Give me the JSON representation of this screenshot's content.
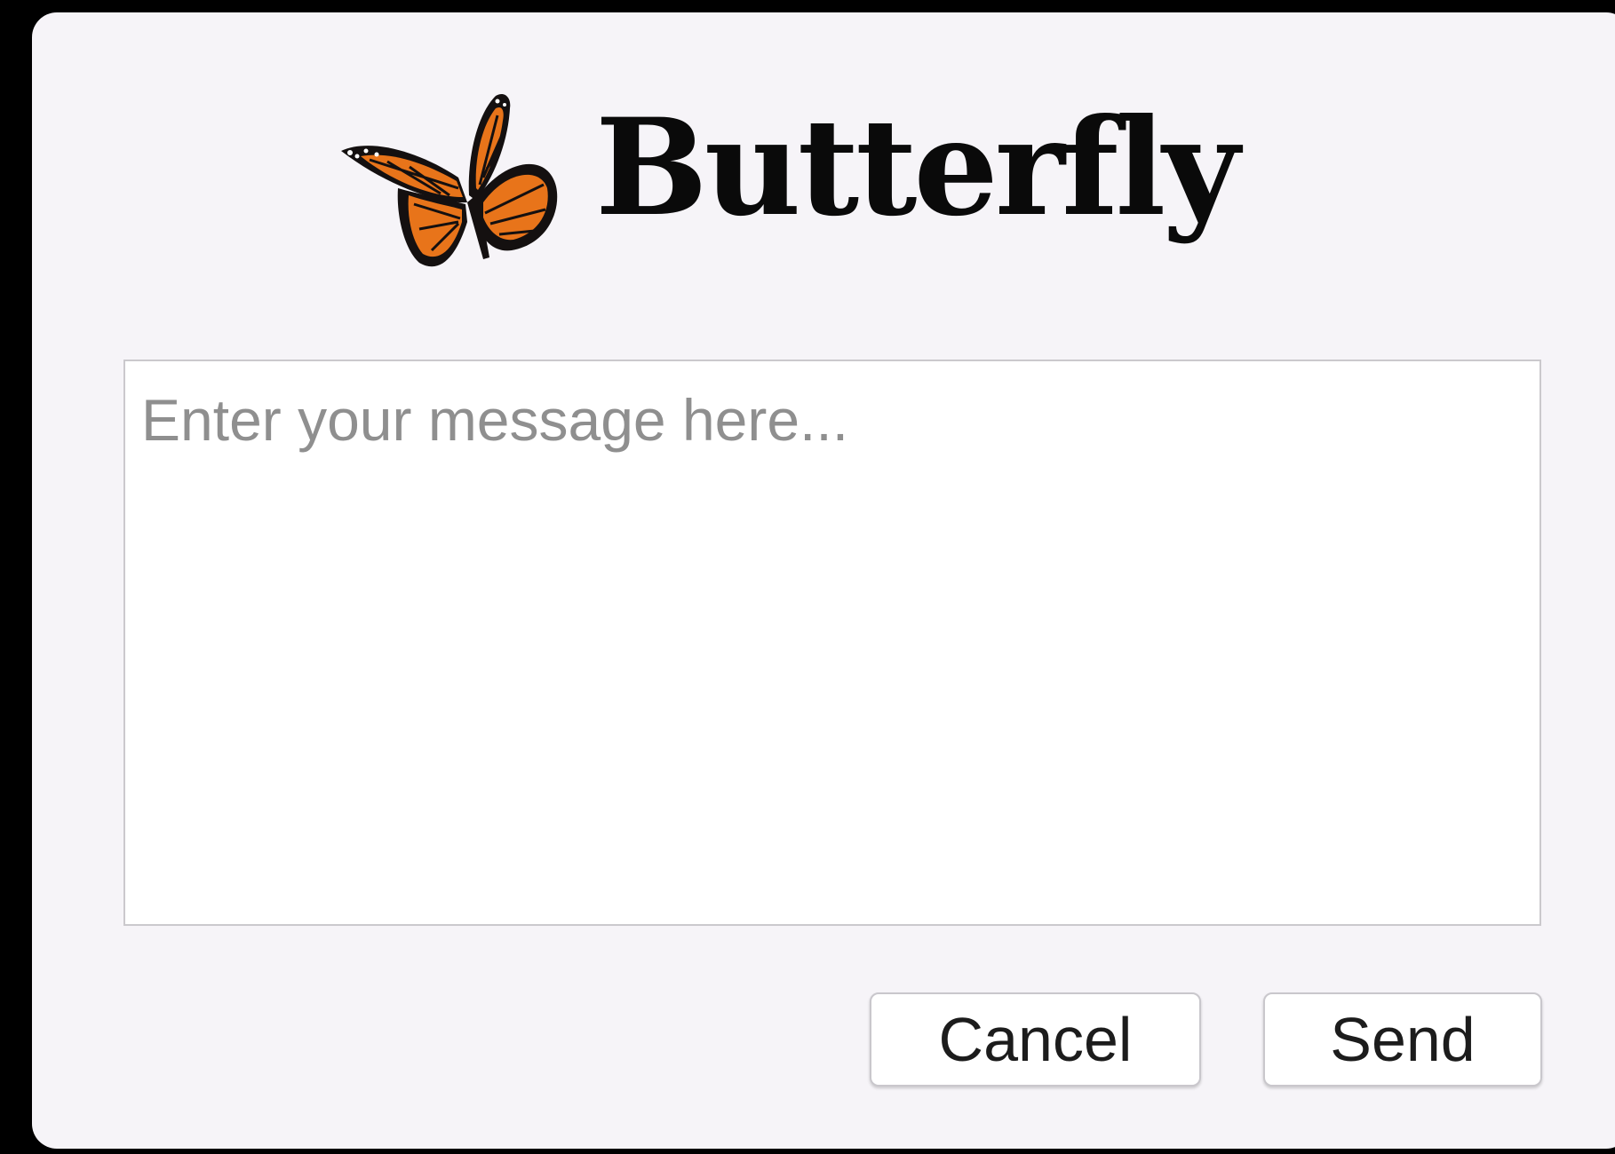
{
  "app": {
    "title": "Butterfly",
    "logo_icon": "monarch-butterfly-icon"
  },
  "message": {
    "value": "",
    "placeholder": "Enter your message here..."
  },
  "actions": {
    "cancel_label": "Cancel",
    "send_label": "Send"
  },
  "colors": {
    "background": "#000000",
    "window": "#f6f4f8",
    "wing_orange": "#e8741a",
    "wing_black": "#141010"
  }
}
